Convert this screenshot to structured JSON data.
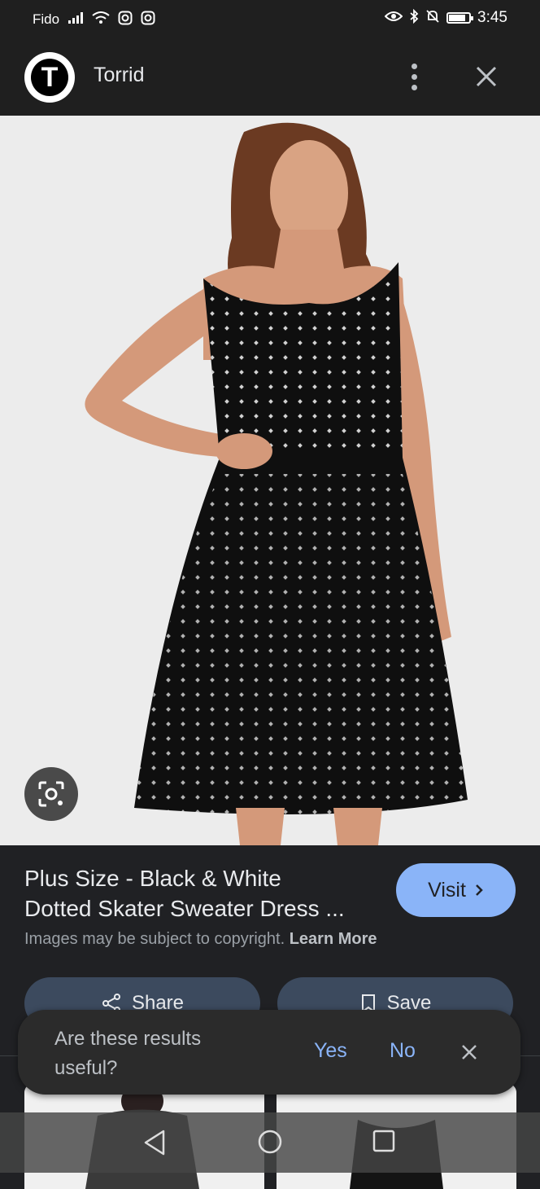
{
  "status_bar": {
    "carrier": "Fido",
    "time": "3:45",
    "battery_level": 0.85
  },
  "header": {
    "logo_letter": "T",
    "site_name": "Torrid"
  },
  "result": {
    "title_line1": "Plus Size - Black & White",
    "title_line2": "Dotted Skater Sweater Dress ...",
    "visit_label": "Visit",
    "copyright_text": "Images may be subject to copyright.",
    "learn_more": "Learn More"
  },
  "actions": {
    "share_label": "Share",
    "save_label": "Save"
  },
  "feedback": {
    "question_line1": "Are these results",
    "question_line2": "useful?",
    "yes_label": "Yes",
    "no_label": "No"
  },
  "colors": {
    "accent": "#8ab4f8",
    "background": "#202124",
    "header": "#1f1f1f",
    "action_button": "#3c4a5e"
  },
  "icons": {
    "more": "more-vert-icon",
    "close": "close-icon",
    "lens": "lens-icon",
    "share": "share-icon",
    "save": "bookmark-icon",
    "chevron": "chevron-right-icon"
  }
}
